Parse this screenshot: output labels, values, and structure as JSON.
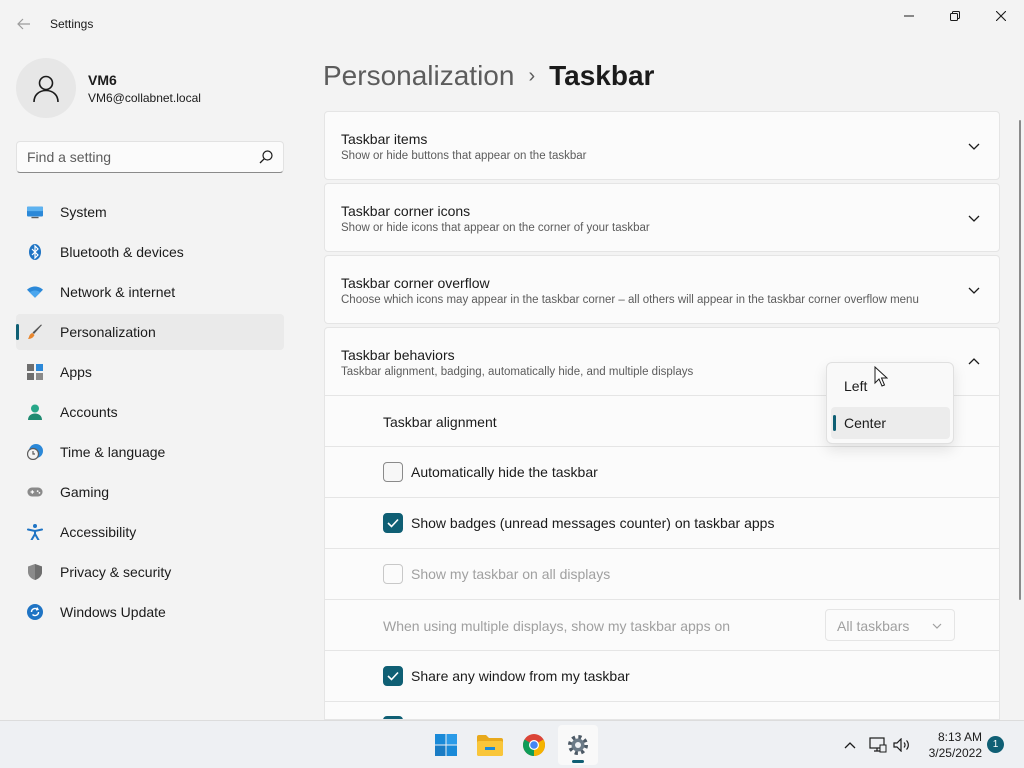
{
  "window": {
    "title": "Settings"
  },
  "user": {
    "name": "VM6",
    "email": "VM6@collabnet.local"
  },
  "search": {
    "placeholder": "Find a setting"
  },
  "nav": {
    "items": [
      {
        "label": "System",
        "icon": "monitor-icon"
      },
      {
        "label": "Bluetooth & devices",
        "icon": "bluetooth-icon"
      },
      {
        "label": "Network & internet",
        "icon": "wifi-icon"
      },
      {
        "label": "Personalization",
        "icon": "brush-icon",
        "active": true
      },
      {
        "label": "Apps",
        "icon": "apps-icon"
      },
      {
        "label": "Accounts",
        "icon": "person-icon"
      },
      {
        "label": "Time & language",
        "icon": "clock-globe-icon"
      },
      {
        "label": "Gaming",
        "icon": "gamepad-icon"
      },
      {
        "label": "Accessibility",
        "icon": "accessibility-icon"
      },
      {
        "label": "Privacy & security",
        "icon": "shield-icon"
      },
      {
        "label": "Windows Update",
        "icon": "refresh-icon"
      }
    ]
  },
  "header": {
    "parent": "Personalization",
    "separator": "›",
    "current": "Taskbar"
  },
  "cards": [
    {
      "title": "Taskbar items",
      "subtitle": "Show or hide buttons that appear on the taskbar",
      "expanded": false
    },
    {
      "title": "Taskbar corner icons",
      "subtitle": "Show or hide icons that appear on the corner of your taskbar",
      "expanded": false
    },
    {
      "title": "Taskbar corner overflow",
      "subtitle": "Choose which icons may appear in the taskbar corner – all others will appear in the taskbar corner overflow menu",
      "expanded": false
    },
    {
      "title": "Taskbar behaviors",
      "subtitle": "Taskbar alignment, badging, automatically hide, and multiple displays",
      "expanded": true
    }
  ],
  "behaviors": {
    "alignment_label": "Taskbar alignment",
    "alignment_options": [
      "Left",
      "Center"
    ],
    "alignment_selected": "Center",
    "auto_hide": {
      "label": "Automatically hide the taskbar",
      "checked": false
    },
    "badges": {
      "label": "Show badges (unread messages counter) on taskbar apps",
      "checked": true
    },
    "all_displays": {
      "label": "Show my taskbar on all displays",
      "checked": false,
      "disabled": true
    },
    "multi_display": {
      "label": "When using multiple displays, show my taskbar apps on",
      "value": "All taskbars",
      "disabled": true
    },
    "share_window": {
      "label": "Share any window from my taskbar",
      "checked": true
    }
  },
  "taskbar": {
    "apps": [
      "start-icon",
      "file-explorer-icon",
      "chrome-icon",
      "settings-icon"
    ],
    "active_app": "settings-icon",
    "clock_time": "8:13 AM",
    "clock_date": "3/25/2022",
    "notification_count": "1"
  },
  "colors": {
    "accent": "#0f5f74",
    "background": "#f3f3f3",
    "card": "#fbfbfb"
  }
}
